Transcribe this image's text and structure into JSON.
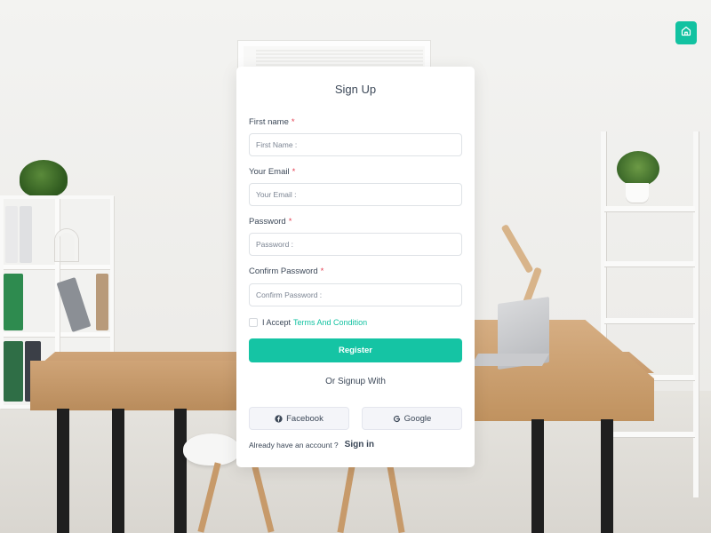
{
  "form": {
    "title": "Sign Up",
    "first_name": {
      "label": "First name",
      "required_mark": "*",
      "placeholder": "First Name :",
      "value": ""
    },
    "email": {
      "label": "Your Email",
      "required_mark": "*",
      "placeholder": "Your Email :",
      "value": ""
    },
    "password": {
      "label": "Password",
      "required_mark": "*",
      "placeholder": "Password :",
      "value": ""
    },
    "confirm_password": {
      "label": "Confirm Password",
      "required_mark": "*",
      "placeholder": "Confirm Password :",
      "value": ""
    },
    "accept_prefix": "I Accept",
    "accept_link": "Terms And Condition",
    "accept_checked": false,
    "register_label": "Register",
    "or_text": "Or Signup With",
    "facebook_label": "Facebook",
    "google_label": "Google",
    "already_text": "Already have an account ?",
    "signin_label": "Sign in"
  },
  "icons": {
    "home": "home-icon",
    "facebook": "facebook-icon",
    "google": "google-icon"
  },
  "colors": {
    "accent": "#15c4a4",
    "required": "#e43f52",
    "text": "#3c4858",
    "card": "#ffffff"
  }
}
